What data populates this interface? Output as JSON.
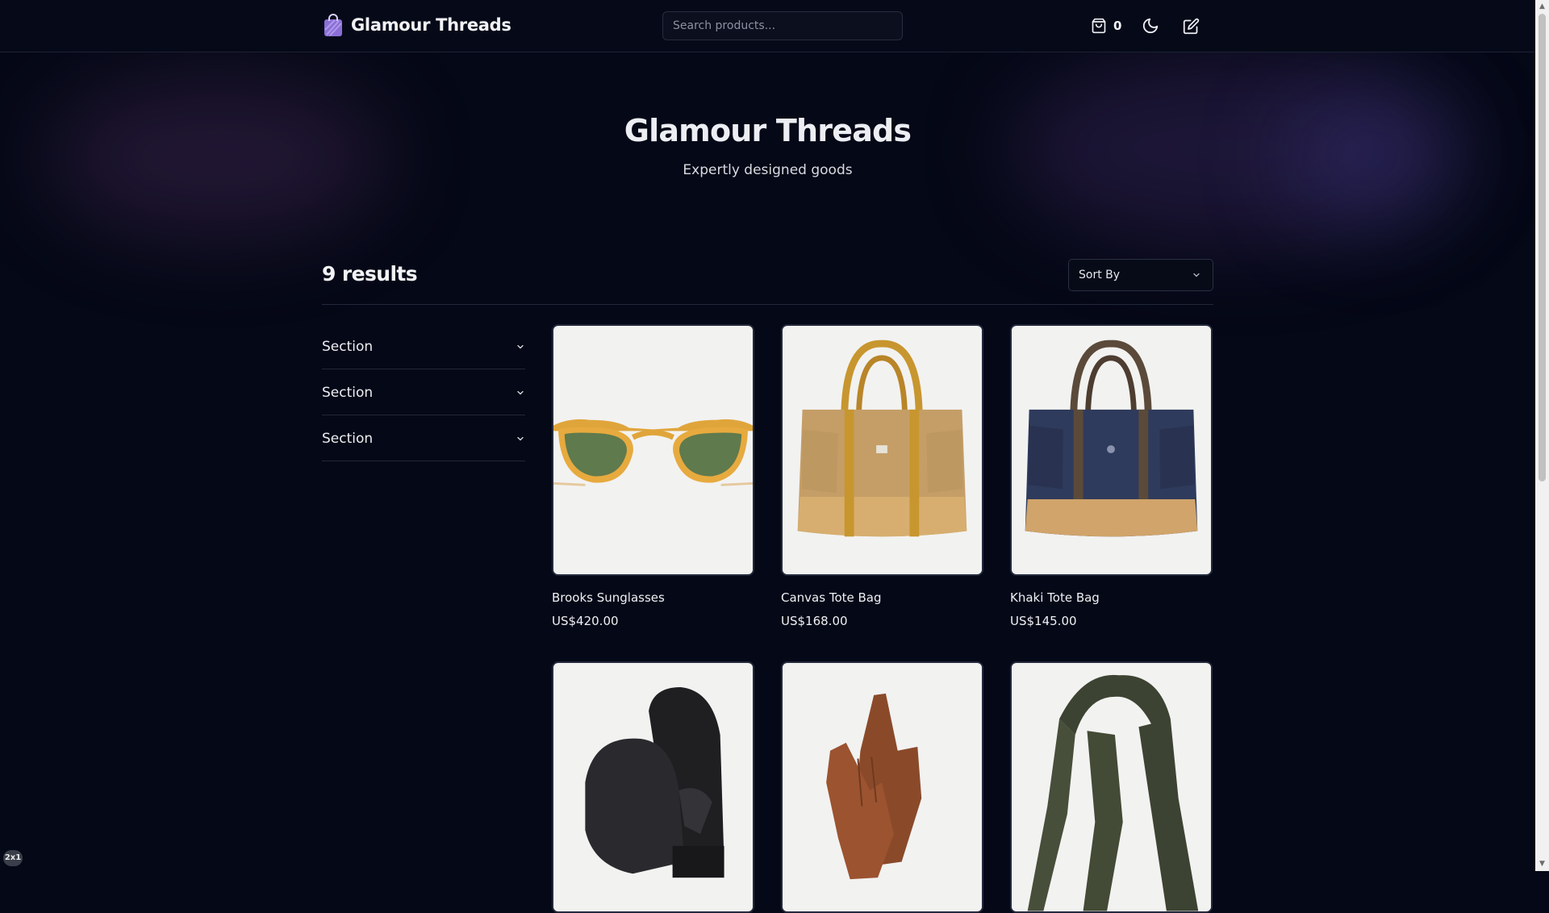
{
  "header": {
    "brand_name": "Glamour Threads",
    "logo_icon": "shopping-bag-icon",
    "search_placeholder": "Search products...",
    "cart_count": "0",
    "cart_icon": "shopping-bag-icon",
    "theme_icon": "moon-icon",
    "edit_icon": "edit-icon"
  },
  "hero": {
    "title": "Glamour Threads",
    "subtitle": "Expertly designed goods"
  },
  "results": {
    "count_label": "9 results",
    "sort_label": "Sort By"
  },
  "filters": [
    {
      "label": "Section"
    },
    {
      "label": "Section"
    },
    {
      "label": "Section"
    }
  ],
  "products": [
    {
      "name": "Brooks Sunglasses",
      "price": "US$420.00"
    },
    {
      "name": "Canvas Tote Bag",
      "price": "US$168.00"
    },
    {
      "name": "Khaki Tote Bag",
      "price": "US$145.00"
    },
    {
      "name": "",
      "price": ""
    },
    {
      "name": "",
      "price": ""
    },
    {
      "name": "",
      "price": ""
    }
  ],
  "badge": "2x1",
  "colors": {
    "background": "#050816",
    "text": "#eceef4",
    "border": "#22283a",
    "logo_purple": "#8b6fd6"
  }
}
